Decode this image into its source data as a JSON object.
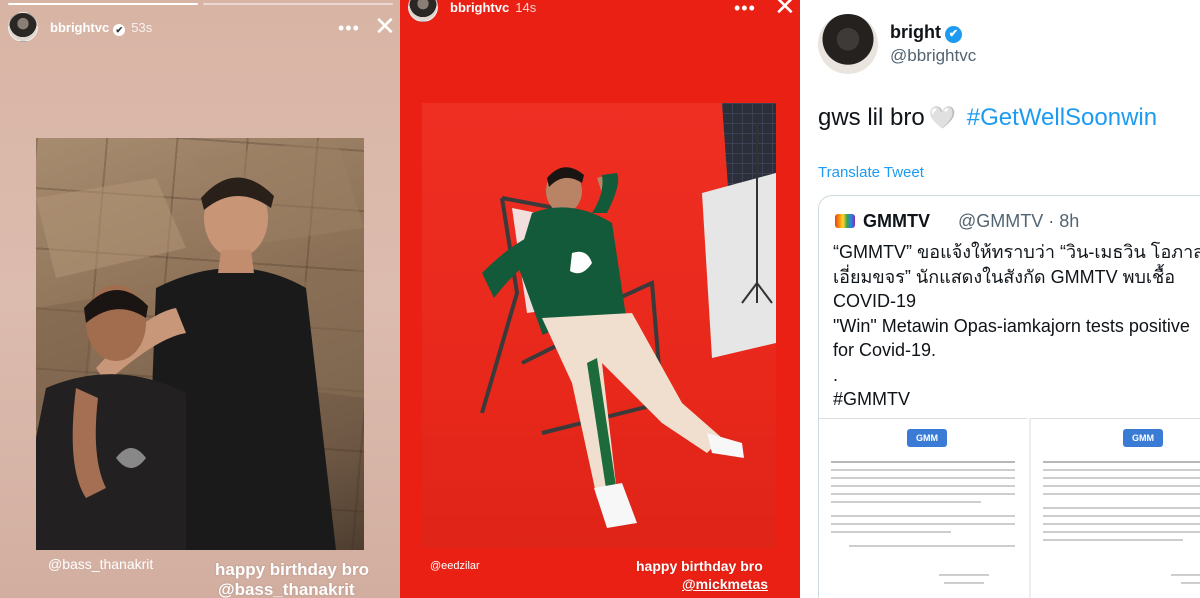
{
  "story1": {
    "username": "bbrightvc",
    "time": "53s",
    "verified_glyph": "✔",
    "more_glyph": "•••",
    "close_glyph": "✕",
    "tag": "@bass_thanakrit",
    "caption_line1": "happy birthday bro",
    "caption_line2": "@bass_thanakrit"
  },
  "story2": {
    "username": "bbrightvc",
    "time": "14s",
    "more_glyph": "•••",
    "close_glyph": "✕",
    "tag": "@eedzilar",
    "caption_line1": "happy birthday bro",
    "caption_line2": "@mickmetas"
  },
  "tweet": {
    "name": "bright",
    "verified_glyph": "✔",
    "handle": "@bbrightvc",
    "text": "gws lil bro",
    "heart": "🤍",
    "hashtag": "#GetWellSoonwin",
    "translate": "Translate Tweet",
    "quote": {
      "name": "GMMTV",
      "handle": "@GMMTV · 8h",
      "lines": [
        "“GMMTV” ขอแจ้งให้ทราบว่า “วิน-เมธวิน โอภาส",
        "เอี่ยมขจร” นักแสดงในสังกัด GMMTV พบเชื้อ",
        "COVID-19",
        "\"Win\" Metawin Opas-iamkajorn tests positive",
        "for Covid-19.",
        ".",
        "#GMMTV"
      ],
      "doc_logo": "GMM"
    }
  },
  "colors": {
    "story1_bg": "#d8b4a4",
    "story2_bg": "#ea2014",
    "twitter_blue": "#1d9bf0"
  }
}
